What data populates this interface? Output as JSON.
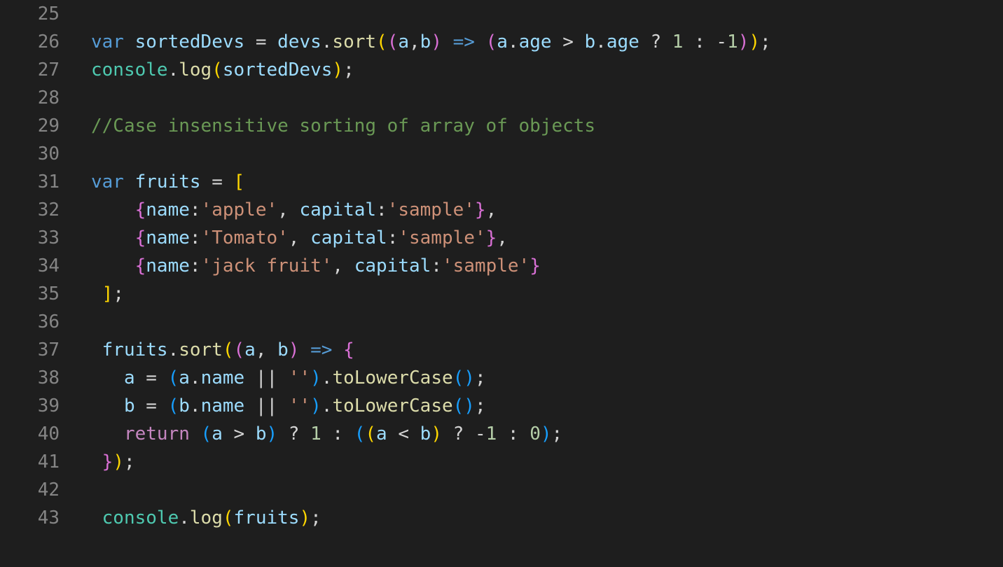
{
  "theme": {
    "background": "#1e1e1e",
    "line_number": "#858585",
    "colors": {
      "kw": "#569cd6",
      "var": "#9cdcfe",
      "fn": "#dcdcaa",
      "obj": "#4ec9b0",
      "op": "#d4d4d4",
      "b1": "#ffd700",
      "b2": "#da70d6",
      "b3": "#179fff",
      "str": "#ce9178",
      "num": "#b5cea8",
      "cm": "#6a9955",
      "ctl": "#c586c0"
    }
  },
  "lines": [
    {
      "num": "25",
      "tokens": []
    },
    {
      "num": "26",
      "tokens": [
        {
          "t": "var",
          "c": "kw"
        },
        {
          "t": " ",
          "c": "op"
        },
        {
          "t": "sortedDevs",
          "c": "var"
        },
        {
          "t": " = ",
          "c": "op"
        },
        {
          "t": "devs",
          "c": "var"
        },
        {
          "t": ".",
          "c": "op"
        },
        {
          "t": "sort",
          "c": "fn"
        },
        {
          "t": "(",
          "c": "b1"
        },
        {
          "t": "(",
          "c": "b2"
        },
        {
          "t": "a",
          "c": "var"
        },
        {
          "t": ",",
          "c": "op"
        },
        {
          "t": "b",
          "c": "var"
        },
        {
          "t": ")",
          "c": "b2"
        },
        {
          "t": " ",
          "c": "op"
        },
        {
          "t": "=>",
          "c": "kw"
        },
        {
          "t": " ",
          "c": "op"
        },
        {
          "t": "(",
          "c": "b2"
        },
        {
          "t": "a",
          "c": "var"
        },
        {
          "t": ".",
          "c": "op"
        },
        {
          "t": "age",
          "c": "var"
        },
        {
          "t": " > ",
          "c": "op"
        },
        {
          "t": "b",
          "c": "var"
        },
        {
          "t": ".",
          "c": "op"
        },
        {
          "t": "age",
          "c": "var"
        },
        {
          "t": " ? ",
          "c": "op"
        },
        {
          "t": "1",
          "c": "num"
        },
        {
          "t": " : ",
          "c": "op"
        },
        {
          "t": "-",
          "c": "op"
        },
        {
          "t": "1",
          "c": "num"
        },
        {
          "t": ")",
          "c": "b2"
        },
        {
          "t": ")",
          "c": "b1"
        },
        {
          "t": ";",
          "c": "op"
        }
      ]
    },
    {
      "num": "27",
      "tokens": [
        {
          "t": "console",
          "c": "obj"
        },
        {
          "t": ".",
          "c": "op"
        },
        {
          "t": "log",
          "c": "fn"
        },
        {
          "t": "(",
          "c": "b1"
        },
        {
          "t": "sortedDevs",
          "c": "var"
        },
        {
          "t": ")",
          "c": "b1"
        },
        {
          "t": ";",
          "c": "op"
        }
      ]
    },
    {
      "num": "28",
      "tokens": []
    },
    {
      "num": "29",
      "tokens": [
        {
          "t": "//Case insensitive sorting of array of objects",
          "c": "cm"
        }
      ]
    },
    {
      "num": "30",
      "tokens": []
    },
    {
      "num": "31",
      "tokens": [
        {
          "t": "var",
          "c": "kw"
        },
        {
          "t": " ",
          "c": "op"
        },
        {
          "t": "fruits",
          "c": "var"
        },
        {
          "t": " = ",
          "c": "op"
        },
        {
          "t": "[",
          "c": "b1"
        }
      ]
    },
    {
      "num": "32",
      "tokens": [
        {
          "t": "    ",
          "c": "op"
        },
        {
          "t": "{",
          "c": "b2"
        },
        {
          "t": "name",
          "c": "var"
        },
        {
          "t": ":",
          "c": "op"
        },
        {
          "t": "'apple'",
          "c": "str"
        },
        {
          "t": ", ",
          "c": "op"
        },
        {
          "t": "capital",
          "c": "var"
        },
        {
          "t": ":",
          "c": "op"
        },
        {
          "t": "'sample'",
          "c": "str"
        },
        {
          "t": "}",
          "c": "b2"
        },
        {
          "t": ",",
          "c": "op"
        }
      ]
    },
    {
      "num": "33",
      "tokens": [
        {
          "t": "    ",
          "c": "op"
        },
        {
          "t": "{",
          "c": "b2"
        },
        {
          "t": "name",
          "c": "var"
        },
        {
          "t": ":",
          "c": "op"
        },
        {
          "t": "'Tomato'",
          "c": "str"
        },
        {
          "t": ", ",
          "c": "op"
        },
        {
          "t": "capital",
          "c": "var"
        },
        {
          "t": ":",
          "c": "op"
        },
        {
          "t": "'sample'",
          "c": "str"
        },
        {
          "t": "}",
          "c": "b2"
        },
        {
          "t": ",",
          "c": "op"
        }
      ]
    },
    {
      "num": "34",
      "tokens": [
        {
          "t": "    ",
          "c": "op"
        },
        {
          "t": "{",
          "c": "b2"
        },
        {
          "t": "name",
          "c": "var"
        },
        {
          "t": ":",
          "c": "op"
        },
        {
          "t": "'jack fruit'",
          "c": "str"
        },
        {
          "t": ", ",
          "c": "op"
        },
        {
          "t": "capital",
          "c": "var"
        },
        {
          "t": ":",
          "c": "op"
        },
        {
          "t": "'sample'",
          "c": "str"
        },
        {
          "t": "}",
          "c": "b2"
        }
      ]
    },
    {
      "num": "35",
      "tokens": [
        {
          "t": " ",
          "c": "op"
        },
        {
          "t": "]",
          "c": "b1"
        },
        {
          "t": ";",
          "c": "op"
        }
      ]
    },
    {
      "num": "36",
      "tokens": []
    },
    {
      "num": "37",
      "tokens": [
        {
          "t": " ",
          "c": "op"
        },
        {
          "t": "fruits",
          "c": "var"
        },
        {
          "t": ".",
          "c": "op"
        },
        {
          "t": "sort",
          "c": "fn"
        },
        {
          "t": "(",
          "c": "b1"
        },
        {
          "t": "(",
          "c": "b2"
        },
        {
          "t": "a",
          "c": "var"
        },
        {
          "t": ", ",
          "c": "op"
        },
        {
          "t": "b",
          "c": "var"
        },
        {
          "t": ")",
          "c": "b2"
        },
        {
          "t": " ",
          "c": "op"
        },
        {
          "t": "=>",
          "c": "kw"
        },
        {
          "t": " ",
          "c": "op"
        },
        {
          "t": "{",
          "c": "b2"
        }
      ]
    },
    {
      "num": "38",
      "tokens": [
        {
          "t": "   ",
          "c": "op"
        },
        {
          "t": "a",
          "c": "var"
        },
        {
          "t": " = ",
          "c": "op"
        },
        {
          "t": "(",
          "c": "b3"
        },
        {
          "t": "a",
          "c": "var"
        },
        {
          "t": ".",
          "c": "op"
        },
        {
          "t": "name",
          "c": "var"
        },
        {
          "t": " || ",
          "c": "op"
        },
        {
          "t": "''",
          "c": "str"
        },
        {
          "t": ")",
          "c": "b3"
        },
        {
          "t": ".",
          "c": "op"
        },
        {
          "t": "toLowerCase",
          "c": "fn"
        },
        {
          "t": "(",
          "c": "b3"
        },
        {
          "t": ")",
          "c": "b3"
        },
        {
          "t": ";",
          "c": "op"
        }
      ]
    },
    {
      "num": "39",
      "tokens": [
        {
          "t": "   ",
          "c": "op"
        },
        {
          "t": "b",
          "c": "var"
        },
        {
          "t": " = ",
          "c": "op"
        },
        {
          "t": "(",
          "c": "b3"
        },
        {
          "t": "b",
          "c": "var"
        },
        {
          "t": ".",
          "c": "op"
        },
        {
          "t": "name",
          "c": "var"
        },
        {
          "t": " || ",
          "c": "op"
        },
        {
          "t": "''",
          "c": "str"
        },
        {
          "t": ")",
          "c": "b3"
        },
        {
          "t": ".",
          "c": "op"
        },
        {
          "t": "toLowerCase",
          "c": "fn"
        },
        {
          "t": "(",
          "c": "b3"
        },
        {
          "t": ")",
          "c": "b3"
        },
        {
          "t": ";",
          "c": "op"
        }
      ]
    },
    {
      "num": "40",
      "tokens": [
        {
          "t": "   ",
          "c": "op"
        },
        {
          "t": "return",
          "c": "ctl"
        },
        {
          "t": " ",
          "c": "op"
        },
        {
          "t": "(",
          "c": "b3"
        },
        {
          "t": "a",
          "c": "var"
        },
        {
          "t": " > ",
          "c": "op"
        },
        {
          "t": "b",
          "c": "var"
        },
        {
          "t": ")",
          "c": "b3"
        },
        {
          "t": " ? ",
          "c": "op"
        },
        {
          "t": "1",
          "c": "num"
        },
        {
          "t": " : ",
          "c": "op"
        },
        {
          "t": "(",
          "c": "b3"
        },
        {
          "t": "(",
          "c": "b1"
        },
        {
          "t": "a",
          "c": "var"
        },
        {
          "t": " < ",
          "c": "op"
        },
        {
          "t": "b",
          "c": "var"
        },
        {
          "t": ")",
          "c": "b1"
        },
        {
          "t": " ? ",
          "c": "op"
        },
        {
          "t": "-",
          "c": "op"
        },
        {
          "t": "1",
          "c": "num"
        },
        {
          "t": " : ",
          "c": "op"
        },
        {
          "t": "0",
          "c": "num"
        },
        {
          "t": ")",
          "c": "b3"
        },
        {
          "t": ";",
          "c": "op"
        }
      ]
    },
    {
      "num": "41",
      "tokens": [
        {
          "t": " ",
          "c": "op"
        },
        {
          "t": "}",
          "c": "b2"
        },
        {
          "t": ")",
          "c": "b1"
        },
        {
          "t": ";",
          "c": "op"
        }
      ]
    },
    {
      "num": "42",
      "tokens": []
    },
    {
      "num": "43",
      "tokens": [
        {
          "t": " ",
          "c": "op"
        },
        {
          "t": "console",
          "c": "obj"
        },
        {
          "t": ".",
          "c": "op"
        },
        {
          "t": "log",
          "c": "fn"
        },
        {
          "t": "(",
          "c": "b1"
        },
        {
          "t": "fruits",
          "c": "var"
        },
        {
          "t": ")",
          "c": "b1"
        },
        {
          "t": ";",
          "c": "op"
        }
      ]
    }
  ]
}
